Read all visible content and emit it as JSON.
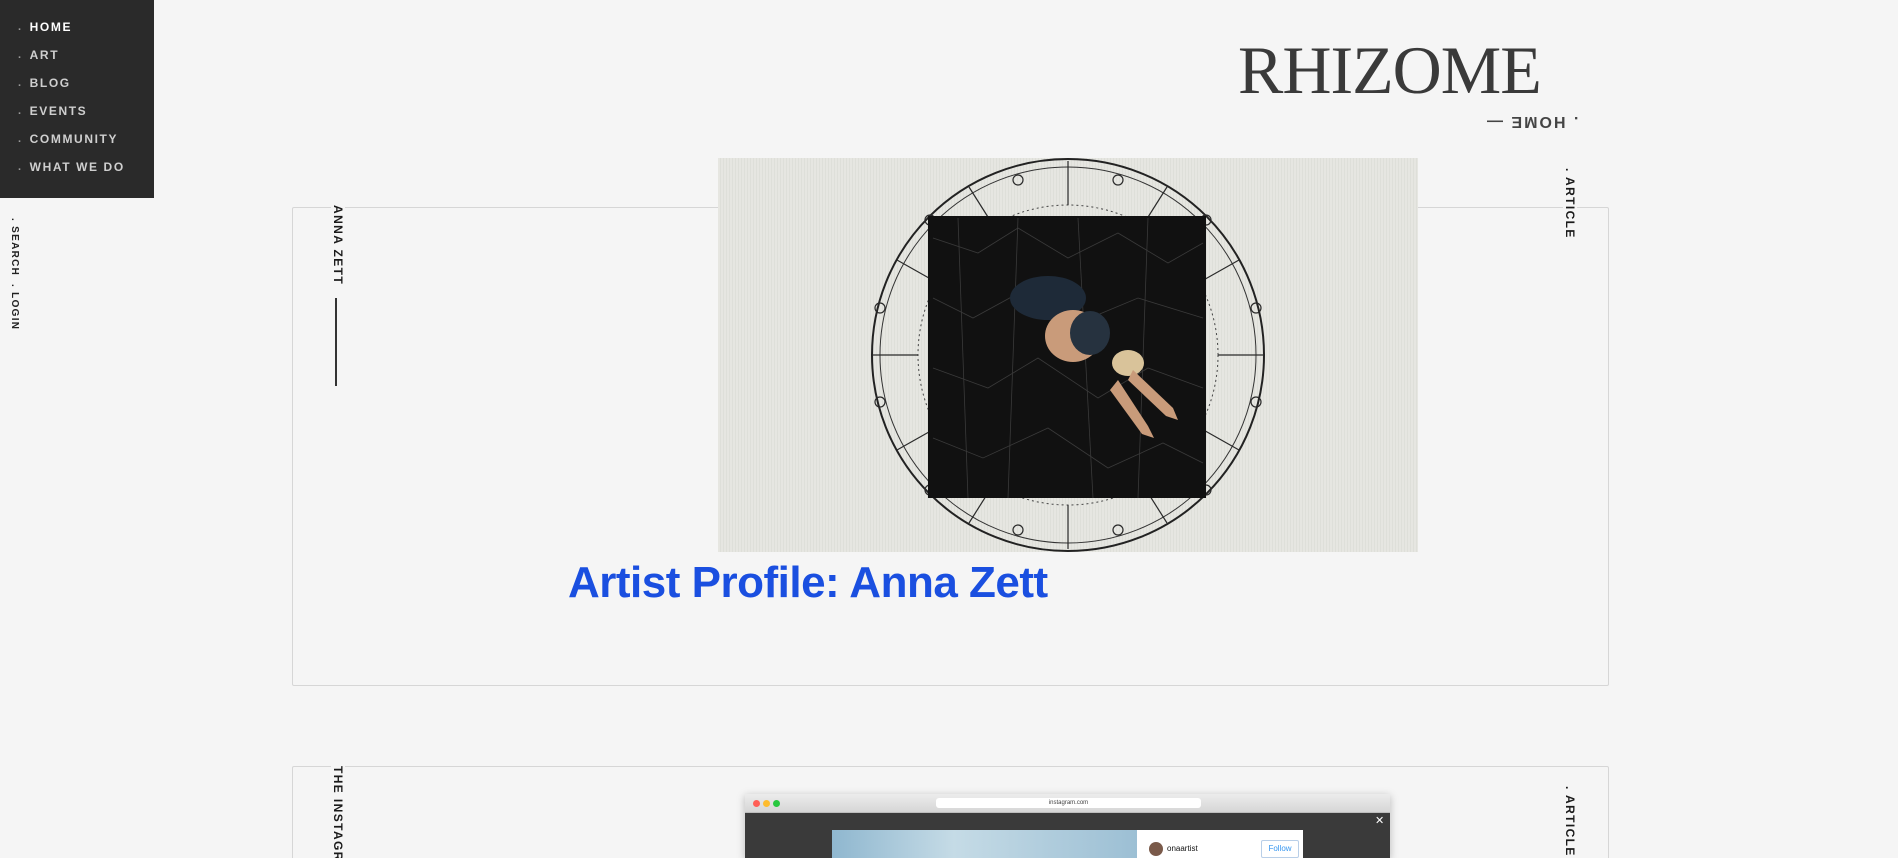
{
  "nav": {
    "items": [
      {
        "label": "HOME",
        "active": true
      },
      {
        "label": "ART",
        "active": false
      },
      {
        "label": "BLOG",
        "active": false
      },
      {
        "label": "EVENTS",
        "active": false
      },
      {
        "label": "COMMUNITY",
        "active": false
      },
      {
        "label": "WHAT WE DO",
        "active": false
      }
    ],
    "bullet": ".",
    "search_label": ". SEARCH",
    "login_label": ". LOGIN"
  },
  "header": {
    "logo_text": "RHIZOME",
    "section_label": ". HOME —"
  },
  "cards": [
    {
      "side_label": "ANNA ZETT",
      "type_label": ". ARTICLE",
      "title": "Artist Profile: Anna Zett",
      "image_name": "artwork-image"
    },
    {
      "side_label": "THE INSTAGR",
      "type_label": ". ARTICLE",
      "screenshot": {
        "url": "instagram.com",
        "username": "onaartist",
        "follow_label": "Follow",
        "close_glyph": "✕"
      }
    }
  ],
  "colors": {
    "nav_bg": "#2a2a2a",
    "title_blue": "#1a4fe0",
    "page_bg": "#f5f5f5",
    "card_border": "#d6d6d6"
  }
}
